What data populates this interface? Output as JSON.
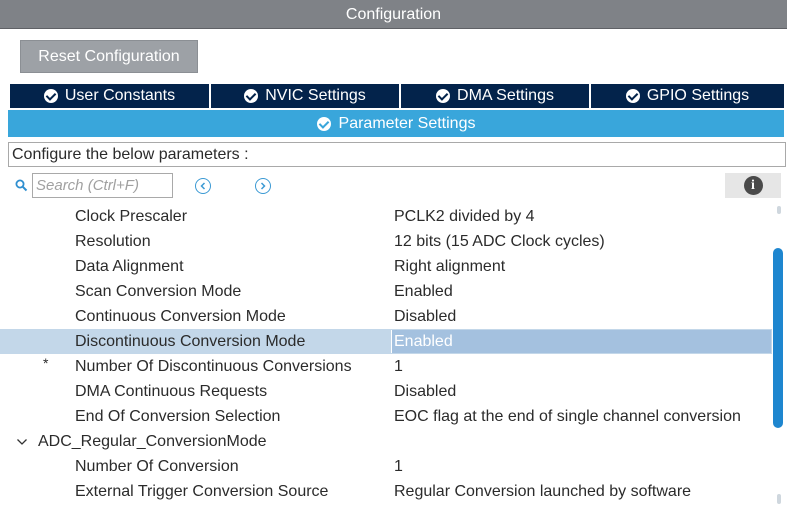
{
  "window": {
    "title": "Configuration"
  },
  "toolbar": {
    "reset_label": "Reset Configuration"
  },
  "tabs": [
    {
      "label": "User Constants"
    },
    {
      "label": "NVIC Settings"
    },
    {
      "label": "DMA Settings"
    },
    {
      "label": "GPIO Settings"
    }
  ],
  "active_tab": {
    "label": "Parameter Settings"
  },
  "configure_text": "Configure the below parameters :",
  "search": {
    "placeholder": "Search (Ctrl+F)",
    "value": ""
  },
  "rows": [
    {
      "type": "param",
      "name": "Clock Prescaler",
      "value": "PCLK2 divided by 4"
    },
    {
      "type": "param",
      "name": "Resolution",
      "value": "12 bits (15 ADC Clock cycles)"
    },
    {
      "type": "param",
      "name": "Data Alignment",
      "value": "Right alignment"
    },
    {
      "type": "param",
      "name": "Scan Conversion Mode",
      "value": "Enabled"
    },
    {
      "type": "param",
      "name": "Continuous Conversion Mode",
      "value": "Disabled"
    },
    {
      "type": "param",
      "name": "Discontinuous Conversion Mode",
      "value": "Enabled",
      "selected": true
    },
    {
      "type": "param",
      "name": "Number Of Discontinuous Conversions",
      "value": "1",
      "marker": "*"
    },
    {
      "type": "param",
      "name": "DMA Continuous Requests",
      "value": "Disabled"
    },
    {
      "type": "param",
      "name": "End Of Conversion Selection",
      "value": "EOC flag at the end of single channel conversion"
    },
    {
      "type": "group",
      "name": "ADC_Regular_ConversionMode"
    },
    {
      "type": "param",
      "name": "Number Of Conversion",
      "value": "1"
    },
    {
      "type": "param",
      "name": "External Trigger Conversion Source",
      "value": "Regular Conversion launched by software"
    }
  ]
}
